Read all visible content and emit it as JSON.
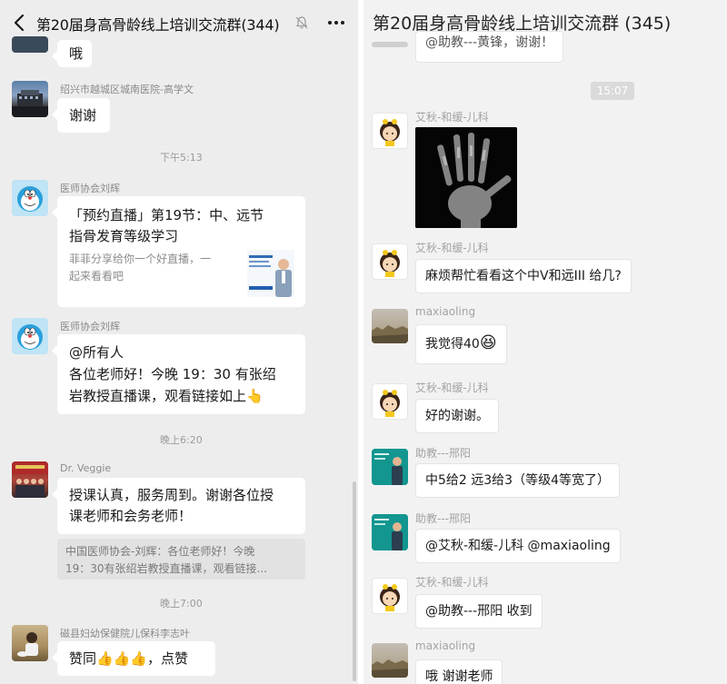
{
  "left": {
    "title": "第20届身高骨龄线上培训交流群(344)",
    "messages": {
      "m0": {
        "text": "哦"
      },
      "m1": {
        "sender": "绍兴市越城区城南医院-高学文",
        "text": "谢谢"
      },
      "ts1": "下午5:13",
      "m2": {
        "sender": "医师协会刘辉",
        "card_title_line1": "「预约直播」第19节：中、远节",
        "card_title_line2": "指骨发育等级学习",
        "card_desc_line1": "菲菲分享给你一个好直播，一",
        "card_desc_line2": "起来看看吧"
      },
      "m3": {
        "sender": "医师协会刘辉",
        "line1": "@所有人",
        "line2": "各位老师好！今晚 19：30 有张绍",
        "line3": "岩教授直播课，观看链接如上",
        "emoji": "👆"
      },
      "ts2": "晚上6:20",
      "m4": {
        "sender": "Dr. Veggie",
        "line1": "授课认真，服务周到。谢谢各位授",
        "line2": "课老师和会务老师！",
        "quote_line1": "中国医师协会-刘辉：各位老师好！今晚",
        "quote_line2": "19：30有张绍岩教授直播课，观看链接..."
      },
      "ts3": "晚上7:00",
      "m5": {
        "sender": "磁县妇幼保健院儿保科李志叶",
        "text": "赞同👍👍👍，点赞"
      }
    }
  },
  "right": {
    "title": "第20届身高骨龄线上培训交流群 (345)",
    "top_partial": "@助教---黄锋，谢谢！",
    "timestamp": "15:07",
    "messages": {
      "r1": {
        "sender": "艾秋-和缓-儿科"
      },
      "r2": {
        "sender": "艾秋-和缓-儿科",
        "text": "麻烦帮忙看看这个中V和远III 给几?"
      },
      "r3": {
        "sender": "maxiaoling",
        "text": "我觉得40",
        "emoji": "😆"
      },
      "r4": {
        "sender": "艾秋-和缓-儿科",
        "text": "好的谢谢。"
      },
      "r5": {
        "sender": "助教---邢阳",
        "text": "中5给2   远3给3（等级4等宽了）"
      },
      "r6": {
        "sender": "助教---邢阳",
        "text": "@艾秋-和缓-儿科 @maxiaoling"
      },
      "r7": {
        "sender": "艾秋-和缓-儿科",
        "text": "@助教---邢阳 收到"
      },
      "r8": {
        "sender": "maxiaoling",
        "text": "哦 谢谢老师"
      }
    }
  },
  "icons": [
    "back-arrow-icon",
    "mute-bell-icon",
    "more-dots-icon",
    "pointing-up-emoji",
    "thumbs-up-emoji",
    "grinning-emoji"
  ],
  "colors": {
    "chat_bg": "#ededed",
    "bubble": "#ffffff",
    "sender_text": "#8a8a8a",
    "timestamp": "#9b9b9b"
  }
}
